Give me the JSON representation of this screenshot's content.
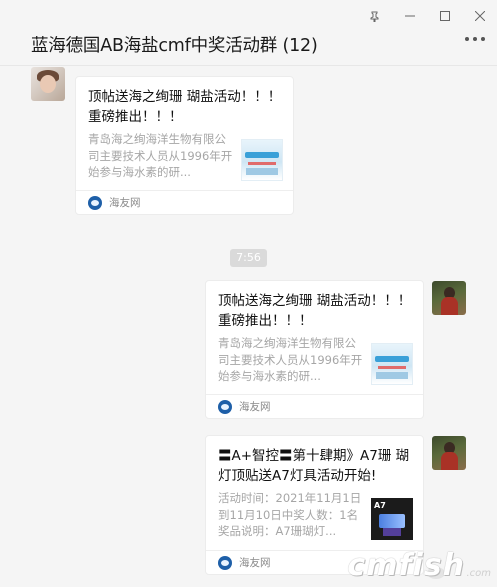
{
  "window": {
    "controls": [
      "pin-icon",
      "minimize-icon",
      "maximize-icon",
      "close-icon"
    ],
    "title": "蓝海德国AB海盐cmf中奖活动群 (12)",
    "more_icon": "more-dots-icon"
  },
  "messages": [
    {
      "side": "left",
      "card_title": "顶帖送海之绚珊 瑚盐活动！！！重磅推出！！！",
      "card_desc": "青岛海之绚海洋生物有限公司主要技术人员从1996年开始参与海水素的研...",
      "source_name": "海友网",
      "thumb": "light"
    },
    {
      "type": "time",
      "text": "7:56"
    },
    {
      "side": "right",
      "card_title": "顶帖送海之绚珊 瑚盐活动！！！重磅推出！！！",
      "card_desc": "青岛海之绚海洋生物有限公司主要技术人员从1996年开始参与海水素的研...",
      "source_name": "海友网",
      "thumb": "light"
    },
    {
      "side": "right",
      "card_title": "〓A+智控〓第十肆期》A7珊 瑚灯顶贴送A7灯具活动开始!",
      "card_desc": "活动时间：2021年11月1日到11月10日中奖人数：1名奖品说明：A7珊瑚灯...",
      "source_name": "海友网",
      "thumb": "dark",
      "thumb_text": "A7"
    }
  ],
  "watermark": {
    "text": "cmfish",
    "sub": ".com"
  },
  "colors": {
    "background": "#f5f5f5",
    "card": "#ffffff",
    "desc_text": "#a6a6a6",
    "source_icon": "#1e5fa8"
  }
}
